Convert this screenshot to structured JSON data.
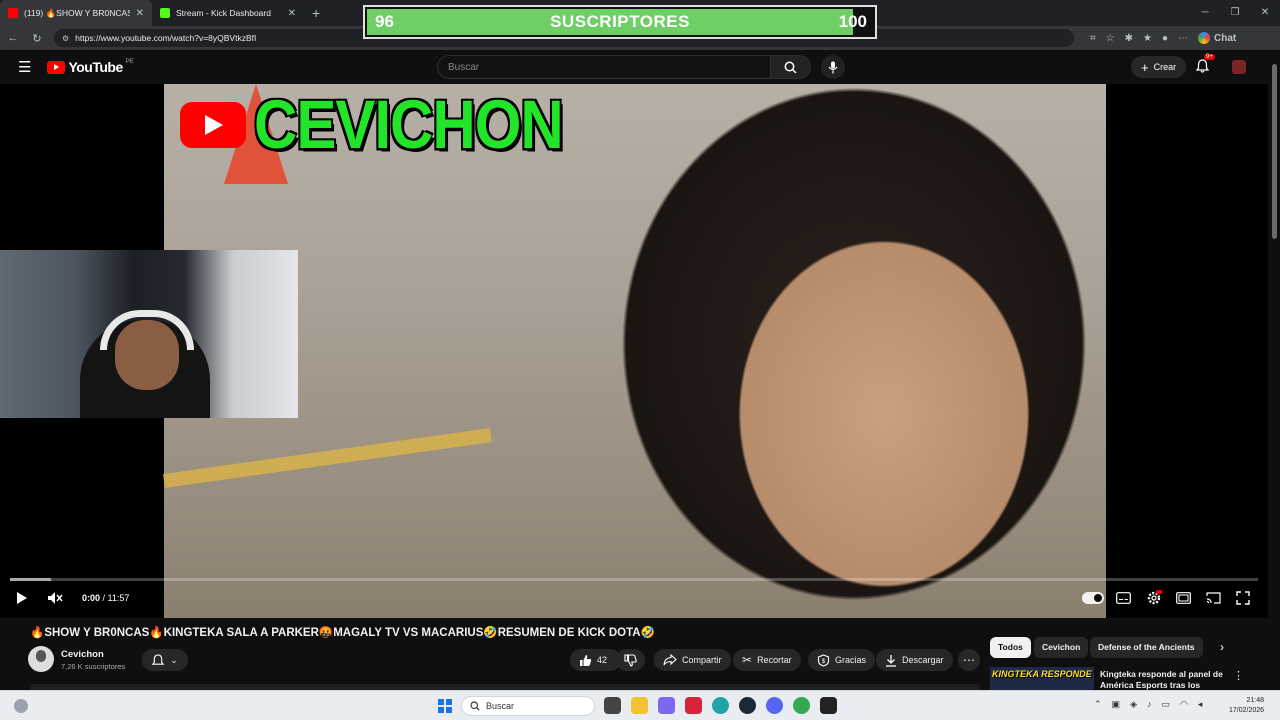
{
  "browser": {
    "tabs": [
      {
        "title": "(119) 🔥SHOW Y BR0NCAS🔥KIN",
        "favicon_color": "#ff0000"
      },
      {
        "title": "Stream - Kick Dashboard",
        "favicon_color": "#53fc18"
      }
    ],
    "new_tab": "+",
    "url": "https://www.youtube.com/watch?v=8yQBVtkzBfI",
    "chat_label": "Chat"
  },
  "sub_goal": {
    "current": 96,
    "goal": 100,
    "label": "SUSCRIPTORES",
    "fill_color": "#6ecf64"
  },
  "youtube": {
    "logo_text": "YouTube",
    "country_code": "PE",
    "search_placeholder": "Buscar",
    "create_label": "Crear",
    "notif_badge": "9+"
  },
  "video": {
    "overlay_channel": "CEVICHON",
    "time_current": "0:00",
    "time_total": "11:57",
    "time_separator": " / ",
    "loaded_fraction": 0.033,
    "title": "🔥SHOW Y BR0NCAS🔥KINGTEKA SALA A PARKER🤬MAGALY TV VS MACARIUS🤣RESUMEN DE KICK DOTA🤣"
  },
  "channel": {
    "name": "Cevichon",
    "subscribers": "7,26 K suscriptores"
  },
  "actions": {
    "likes": "42",
    "share": "Compartir",
    "clip": "Recortar",
    "thanks": "Gracias",
    "download": "Descargar"
  },
  "chips": [
    "Todos",
    "Cevichon",
    "Defense of the Ancients"
  ],
  "recommendation": {
    "thumb_text": "KINGTEKA RESPONDE A PANEL DE",
    "title": "Kingteka responde al panel de América Esports tras los"
  },
  "taskbar": {
    "search_label": "Buscar",
    "time": "21:48",
    "date": "17/02/2026"
  }
}
